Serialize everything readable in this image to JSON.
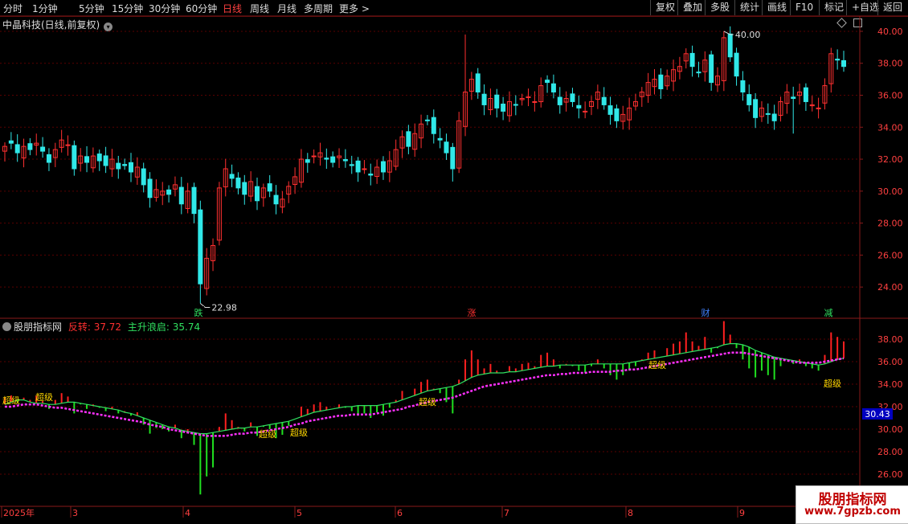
{
  "toolbar": {
    "periods": [
      "分时",
      "1分钟",
      "5分钟",
      "15分钟",
      "30分钟",
      "60分钟",
      "日线",
      "周线",
      "月线",
      "多周期",
      "更多 >"
    ],
    "active_period": "日线",
    "buttons": [
      "复权",
      "叠加",
      "多股",
      "统计",
      "画线",
      "F10",
      "+自选",
      "返回"
    ],
    "mark_label": "标记"
  },
  "stock": {
    "title": "中晶科技(日线,前复权)"
  },
  "colors": {
    "up": "#ff3030",
    "down": "#30e8e8",
    "ma": "#ffffff",
    "grid": "#5a0000",
    "axis": "#8a1a1a"
  },
  "main_axis": {
    "ticks": [
      "40.00",
      "38.00",
      "36.00",
      "34.00",
      "32.00",
      "30.00",
      "28.00",
      "26.00",
      "24.00"
    ]
  },
  "annotations": {
    "high_label": "40.00",
    "low_label": "22.98"
  },
  "signals": [
    {
      "text": "跌",
      "color": "#30e060"
    },
    {
      "text": "涨",
      "color": "#ff3030"
    },
    {
      "text": "财",
      "color": "#4080ff"
    },
    {
      "text": "减",
      "color": "#30e060"
    }
  ],
  "indicator": {
    "name": "股朋指标网",
    "label1": "反转: 37.72",
    "label2": "主升浪启: 35.74",
    "ticks": [
      "38.00",
      "36.00",
      "34.00",
      "32.00",
      "30.00",
      "28.00",
      "26.00"
    ],
    "current_tag": "30.43",
    "super_label": "超级"
  },
  "date_axis": [
    "2025年",
    "3",
    "4",
    "5",
    "6",
    "7",
    "8",
    "9"
  ],
  "watermark": {
    "line1": "股朋指标网",
    "line2": "www.7gpzb.com"
  },
  "chart_data": {
    "type": "candlestick",
    "ylim": [
      22.5,
      40.5
    ],
    "low": 22.98,
    "high": 40.0,
    "closes": [
      32.8,
      33.0,
      32.4,
      32.8,
      32.6,
      33.0,
      32.5,
      31.8,
      32.6,
      33.2,
      32.9,
      31.4,
      32.2,
      31.8,
      32.2,
      31.9,
      31.6,
      32.0,
      31.4,
      31.6,
      31.2,
      31.5,
      30.4,
      29.6,
      30.1,
      30.0,
      29.8,
      30.4,
      29.2,
      30.0,
      28.6,
      24.2,
      25.8,
      26.6,
      30.2,
      31.4,
      30.8,
      30.2,
      29.8,
      30.6,
      29.4,
      30.2,
      30.0,
      29.2,
      29.5,
      30.3,
      30.9,
      32.0,
      31.8,
      32.2,
      32.4,
      32.0,
      31.8,
      32.2,
      31.9,
      31.6,
      31.2,
      31.4,
      31.0,
      31.5,
      31.2,
      31.9,
      32.6,
      33.4,
      32.8,
      33.6,
      34.2,
      34.4,
      33.6,
      33.2,
      32.4,
      31.4,
      34.4,
      36.2,
      37.0,
      36.2,
      35.4,
      35.8,
      35.2,
      35.0,
      35.6,
      35.4,
      35.8,
      35.9,
      35.6,
      36.6,
      36.8,
      36.2,
      35.4,
      35.8,
      35.6,
      35.2,
      35.0,
      35.6,
      36.2,
      35.4,
      34.8,
      34.4,
      34.8,
      35.2,
      35.6,
      36.2,
      36.8,
      37.0,
      36.4,
      37.2,
      37.6,
      37.8,
      38.6,
      37.8,
      37.4,
      38.2,
      36.8,
      37.2,
      39.6,
      38.4,
      37.2,
      36.2,
      35.4,
      34.6,
      35.2,
      34.8,
      34.4,
      35.6,
      36.2,
      35.8,
      36.2,
      35.6,
      35.4,
      35.2,
      36.6,
      38.6,
      38.2,
      37.8
    ],
    "indicator_ylim": [
      25.0,
      39.0
    ],
    "reversal_line": [
      32.2,
      32.4,
      32.6,
      32.6,
      32.4,
      32.3,
      32.3,
      32.2,
      32.2,
      32.3,
      32.4,
      32.4,
      32.3,
      32.2,
      32.1,
      32.0,
      31.9,
      31.8,
      31.7,
      31.5,
      31.4,
      31.2,
      31.0,
      30.8,
      30.6,
      30.4,
      30.2,
      30.1,
      29.9,
      29.8,
      29.7,
      29.6,
      29.6,
      29.7,
      29.8,
      29.9,
      30.0,
      30.1,
      30.1,
      30.2,
      30.2,
      30.3,
      30.4,
      30.5,
      30.6,
      30.7,
      30.9,
      31.1,
      31.3,
      31.5,
      31.6,
      31.7,
      31.8,
      31.9,
      32.0,
      32.0,
      32.1,
      32.1,
      32.1,
      32.1,
      32.2,
      32.3,
      32.4,
      32.6,
      32.8,
      33.0,
      33.2,
      33.4,
      33.5,
      33.6,
      33.7,
      33.8,
      34.0,
      34.3,
      34.6,
      34.8,
      34.9,
      35.0,
      35.0,
      35.0,
      35.1,
      35.1,
      35.2,
      35.3,
      35.4,
      35.5,
      35.6,
      35.6,
      35.7,
      35.7,
      35.7,
      35.7,
      35.7,
      35.8,
      35.8,
      35.8,
      35.8,
      35.8,
      35.8,
      35.9,
      36.0,
      36.1,
      36.2,
      36.3,
      36.4,
      36.5,
      36.6,
      36.7,
      36.8,
      36.9,
      37.0,
      37.1,
      37.2,
      37.3,
      37.5,
      37.6,
      37.6,
      37.5,
      37.3,
      37.0,
      36.8,
      36.6,
      36.4,
      36.3,
      36.2,
      36.1,
      36.0,
      35.9,
      35.8,
      35.7,
      35.8,
      36.0,
      36.2,
      36.3
    ],
    "main_rise_line": [
      32.0,
      32.0,
      32.1,
      32.2,
      32.2,
      32.2,
      32.1,
      32.0,
      31.9,
      31.9,
      31.8,
      31.7,
      31.6,
      31.5,
      31.4,
      31.3,
      31.2,
      31.1,
      31.0,
      30.9,
      30.8,
      30.7,
      30.6,
      30.4,
      30.3,
      30.2,
      30.0,
      29.9,
      29.8,
      29.7,
      29.6,
      29.5,
      29.4,
      29.4,
      29.4,
      29.4,
      29.5,
      29.6,
      29.6,
      29.7,
      29.7,
      29.8,
      29.9,
      30.0,
      30.1,
      30.2,
      30.4,
      30.5,
      30.7,
      30.8,
      30.9,
      31.0,
      31.1,
      31.2,
      31.2,
      31.3,
      31.3,
      31.3,
      31.3,
      31.4,
      31.5,
      31.6,
      31.7,
      31.8,
      32.0,
      32.1,
      32.3,
      32.4,
      32.5,
      32.6,
      32.7,
      32.8,
      33.0,
      33.2,
      33.4,
      33.6,
      33.8,
      33.9,
      34.0,
      34.1,
      34.2,
      34.3,
      34.4,
      34.5,
      34.6,
      34.7,
      34.8,
      34.8,
      34.9,
      34.9,
      35.0,
      35.0,
      35.0,
      35.1,
      35.1,
      35.1,
      35.1,
      35.2,
      35.2,
      35.3,
      35.3,
      35.4,
      35.5,
      35.6,
      35.7,
      35.8,
      35.9,
      36.0,
      36.1,
      36.2,
      36.3,
      36.4,
      36.5,
      36.6,
      36.7,
      36.8,
      36.8,
      36.8,
      36.7,
      36.6,
      36.5,
      36.4,
      36.3,
      36.2,
      36.1,
      36.0,
      35.9,
      35.9,
      35.9,
      35.9,
      36.0,
      36.1,
      36.2,
      36.3
    ]
  }
}
